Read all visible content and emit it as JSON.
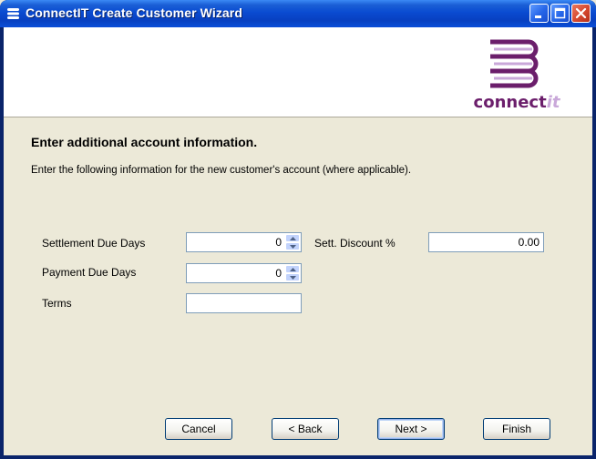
{
  "window": {
    "title": "ConnectIT Create Customer Wizard"
  },
  "logo": {
    "text_main": "connect",
    "text_accent": "it"
  },
  "page": {
    "heading": "Enter additional account information.",
    "description": "Enter the following information for the new customer's account (where applicable)."
  },
  "fields": {
    "settlement_due_days": {
      "label": "Settlement Due Days",
      "value": "0"
    },
    "payment_due_days": {
      "label": "Payment Due Days",
      "value": "0"
    },
    "terms": {
      "label": "Terms",
      "value": ""
    },
    "sett_discount": {
      "label": "Sett. Discount %",
      "value": "0.00"
    }
  },
  "buttons": {
    "cancel": "Cancel",
    "back": "< Back",
    "next": "Next >",
    "finish": "Finish"
  },
  "colors": {
    "titlebar": "#0A4BD1",
    "dialog_bg": "#ECE9D8",
    "logo_purple": "#6B1E6B"
  }
}
